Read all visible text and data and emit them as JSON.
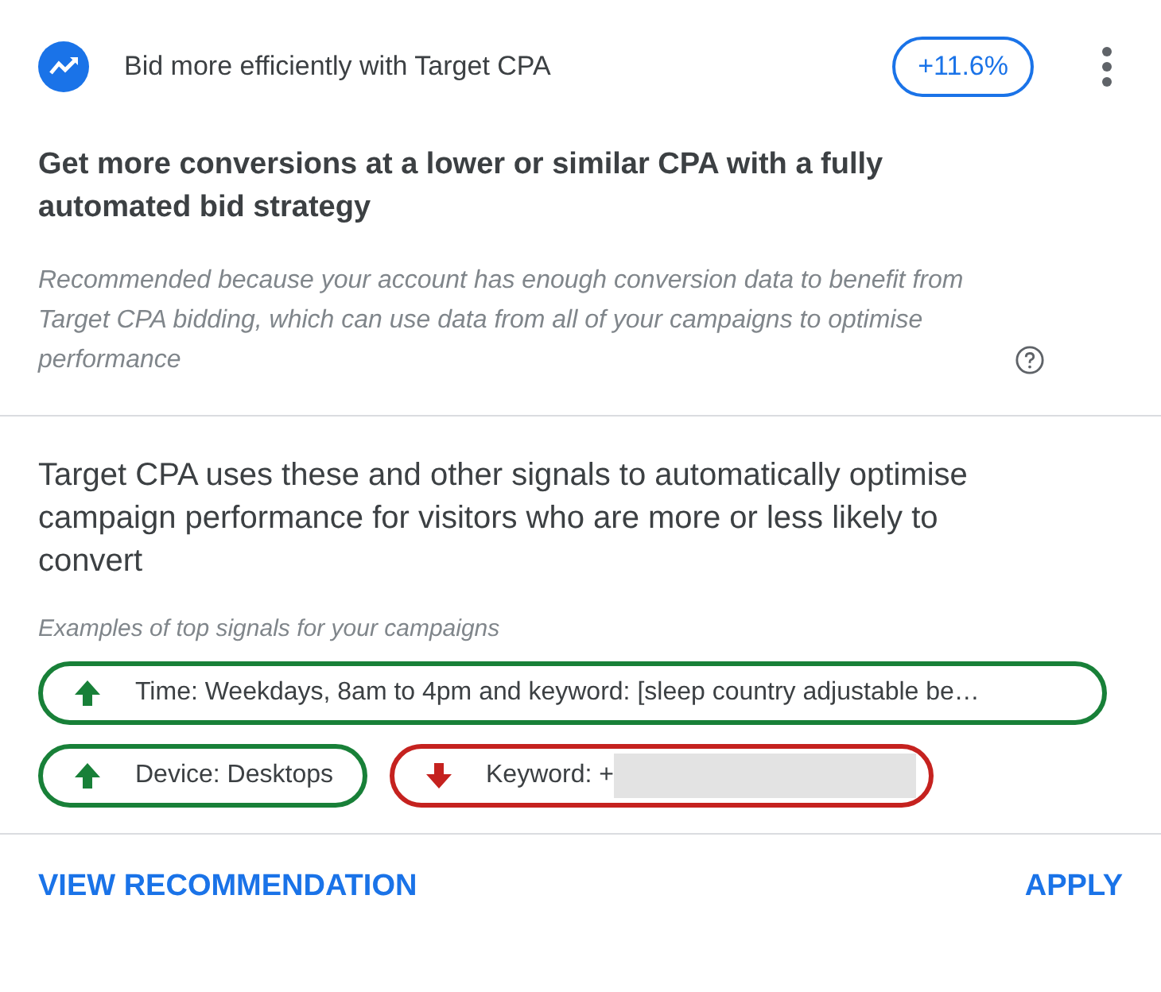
{
  "header": {
    "title": "Bid more efficiently with Target CPA",
    "badge": "+11.6%"
  },
  "headline": "Get more conversions at a lower or similar CPA with a fully automated bid strategy",
  "reason": "Recommended because your account has enough conversion data to benefit from Target CPA bidding, which can use data from all of your campaigns to optimise performance",
  "description": "Target CPA uses these and other signals to automatically optimise campaign performance for visitors who are more or less likely to convert",
  "signals_caption": "Examples of top signals for your campaigns",
  "signals": [
    [
      {
        "kind": "up",
        "label": "Time: Weekdays, 8am to 4pm and keyword: [sleep country adjustable be…",
        "redacted": false
      }
    ],
    [
      {
        "kind": "up",
        "label": "Device: Desktops",
        "redacted": false
      },
      {
        "kind": "down",
        "label": "Keyword: +",
        "redacted": true
      }
    ]
  ],
  "actions": {
    "left": "VIEW RECOMMENDATION",
    "right": "APPLY"
  }
}
